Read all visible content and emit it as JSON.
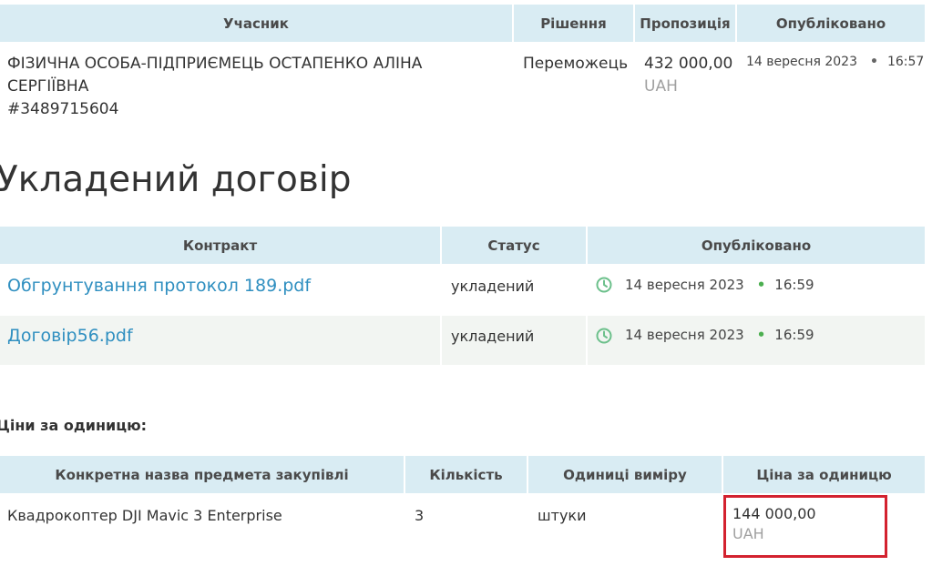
{
  "participants_table": {
    "headers": [
      "Учасник",
      "Рішення",
      "Пропозиція",
      "Опубліковано"
    ],
    "row": {
      "participant_name": "ФІЗИЧНА ОСОБА-ПІДПРИЄМЕЦЬ ОСТАПЕНКО АЛІНА СЕРГІЇВНА",
      "participant_id": "#3489715604",
      "decision": "Переможець",
      "amount": "432 000,00",
      "currency": "UAH",
      "date": "14 вересня 2023",
      "time": "16:57"
    }
  },
  "contract_section": {
    "title": "Укладений договір",
    "headers": [
      "Контракт",
      "Статус",
      "Опубліковано"
    ],
    "rows": [
      {
        "file": "Обгрунтування протокол 189.pdf",
        "status": "укладений",
        "date": "14 вересня 2023",
        "time": "16:59"
      },
      {
        "file": "Договір56.pdf",
        "status": "укладений",
        "date": "14 вересня 2023",
        "time": "16:59"
      }
    ]
  },
  "unit_prices": {
    "title": "Ціни за одиницю:",
    "headers": [
      "Конкретна назва предмета закупівлі",
      "Кількість",
      "Одиниці виміру",
      "Ціна за одиницю"
    ],
    "row": {
      "item": "Квадрокоптер DJI Mavic 3 Enterprise",
      "quantity": "3",
      "unit": "штуки",
      "price": "144 000,00",
      "currency": "UAH"
    }
  },
  "colors": {
    "header_bg": "#d9ecf3",
    "link": "#2f8fc0",
    "highlight_border": "#d3222f",
    "clock_icon": "#6cc08b"
  },
  "icons": [
    "clock-icon"
  ]
}
